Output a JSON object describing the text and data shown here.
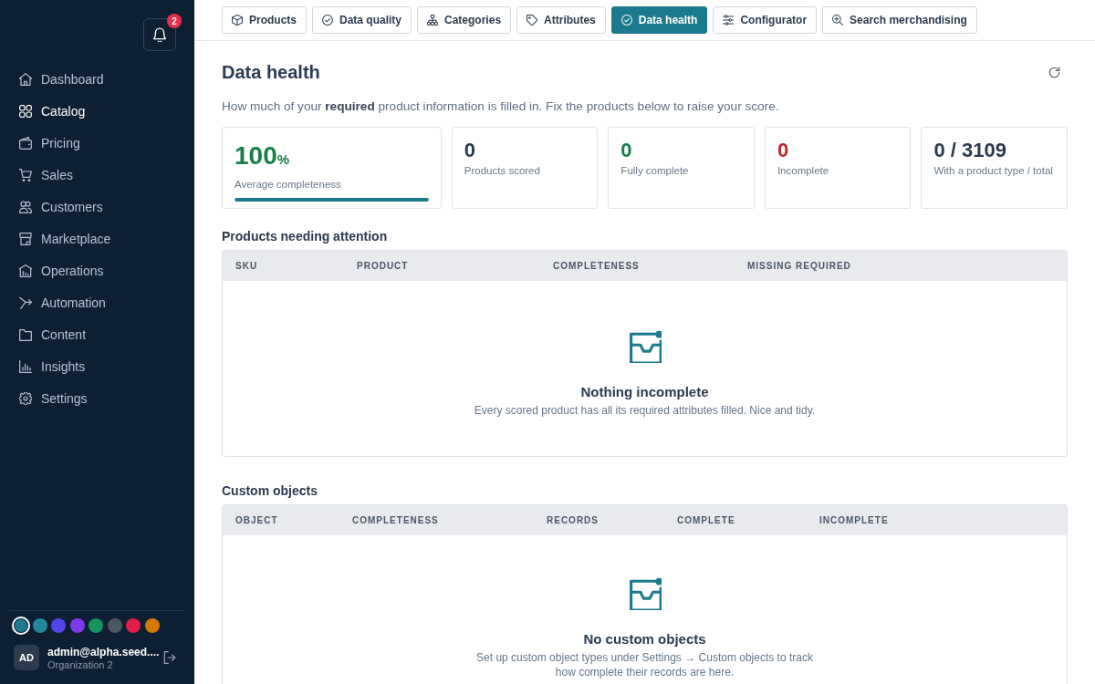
{
  "sidebar": {
    "notifications": {
      "badge": "2"
    },
    "nav": [
      {
        "label": "Dashboard",
        "selected": false
      },
      {
        "label": "Catalog",
        "selected": true
      },
      {
        "label": "Pricing",
        "selected": false
      },
      {
        "label": "Sales",
        "selected": false
      },
      {
        "label": "Customers",
        "selected": false
      },
      {
        "label": "Marketplace",
        "selected": false
      },
      {
        "label": "Operations",
        "selected": false
      },
      {
        "label": "Automation",
        "selected": false
      },
      {
        "label": "Content",
        "selected": false
      },
      {
        "label": "Insights",
        "selected": false
      },
      {
        "label": "Settings",
        "selected": false
      }
    ],
    "swatches": [
      {
        "color": "#1d7a8e",
        "selected": true
      },
      {
        "color": "#25869a",
        "selected": false
      },
      {
        "color": "#4f46e5",
        "selected": false
      },
      {
        "color": "#7c3aed",
        "selected": false
      },
      {
        "color": "#16935c",
        "selected": false
      },
      {
        "color": "#4b5563",
        "selected": false
      },
      {
        "color": "#e11d48",
        "selected": false
      },
      {
        "color": "#d97706",
        "selected": false
      }
    ],
    "user": {
      "initials": "AD",
      "email": "admin@alpha.seed....",
      "organization": "Organization 2"
    }
  },
  "tabs": [
    {
      "label": "Products",
      "selected": false
    },
    {
      "label": "Data quality",
      "selected": false
    },
    {
      "label": "Categories",
      "selected": false
    },
    {
      "label": "Attributes",
      "selected": false
    },
    {
      "label": "Data health",
      "selected": true
    },
    {
      "label": "Configurator",
      "selected": false
    },
    {
      "label": "Search merchandising",
      "selected": false
    }
  ],
  "page": {
    "title": "Data health",
    "description": "How much of your **required** product information is filled in. Fix the products below to raise your score."
  },
  "stats": [
    {
      "kind": "progress",
      "value": "100",
      "unit": "%",
      "label": "Average completeness",
      "color": "#178046",
      "level": 1
    },
    {
      "kind": "count",
      "value": "0",
      "label": "Products scored",
      "color": "#2b3a4e"
    },
    {
      "kind": "count",
      "value": "0",
      "label": "Fully complete",
      "color": "#178046"
    },
    {
      "kind": "count",
      "value": "0",
      "label": "Incomplete",
      "color": "#c0262d"
    },
    {
      "kind": "count",
      "value": "0 / 3109",
      "label": "With a product type / total",
      "color": "#2b3a4e"
    }
  ],
  "sections": [
    {
      "title": "Products needing attention",
      "columns": [
        "SKU",
        "PRODUCT",
        "COMPLETENESS",
        "MISSING REQUIRED"
      ],
      "empty": {
        "title": "Nothing incomplete",
        "text": "Every scored product has all its required attributes filled. Nice and tidy."
      }
    },
    {
      "title": "Custom objects",
      "columns": [
        "OBJECT",
        "COMPLETENESS",
        "RECORDS",
        "COMPLETE",
        "INCOMPLETE"
      ],
      "empty": {
        "title": "No custom objects",
        "text": "Set up custom object types under Settings → Custom objects to track how complete their records are here."
      }
    }
  ]
}
